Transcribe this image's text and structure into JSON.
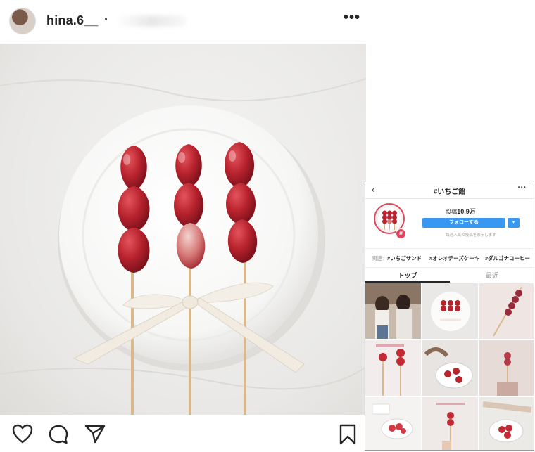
{
  "post": {
    "username": "hina.6__",
    "separator": "·",
    "more_icon": "more-dots-icon"
  },
  "actions": {
    "icons": [
      "heart-icon",
      "comment-icon",
      "share-icon",
      "bookmark-icon"
    ]
  },
  "inset": {
    "back_icon": "‹",
    "title": "#いちご飴",
    "more": "···",
    "posts_label": "投稿",
    "posts_count": "10.9万",
    "follow_button": "フォローする",
    "dropdown": "▾",
    "note": "毎週人気の投稿を表示します",
    "related_label": "関連:",
    "related_tags": [
      "#いちごサンド",
      "#オレオチーズケーキ",
      "#ダルゴナコーヒー"
    ],
    "tabs": [
      "トップ",
      "最近"
    ],
    "hash_badge": "#"
  },
  "colors": {
    "accent": "#3897f0",
    "hashtag_ring": "#e0455e",
    "strawberry": "#b8232e"
  }
}
